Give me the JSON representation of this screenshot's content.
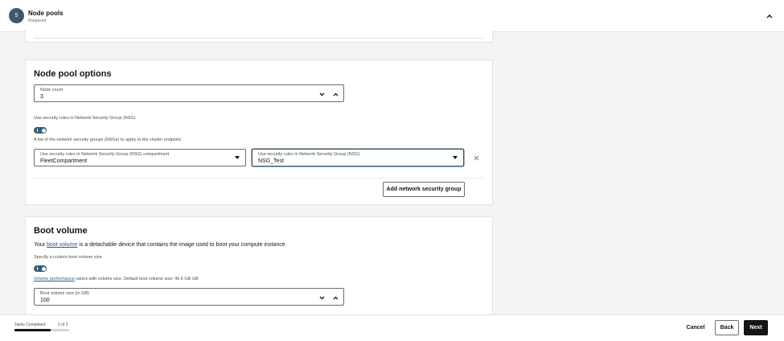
{
  "header": {
    "step_number": "5",
    "title": "Node pools",
    "subtitle": "Required",
    "collapse_icon": "chevron-up-icon"
  },
  "node_pool_options": {
    "title": "Node pool options",
    "node_count": {
      "label": "Node count",
      "value": "3"
    },
    "nsg_toggle_label": "Use security rules in Network Security Group (NSG)",
    "nsg_toggle_on": true,
    "nsg_help": "A list of the network security groups (NSGs) to apply to the cluster endpoint.",
    "nsg_compartment": {
      "label": "Use security rules in Network Security Group (NSG) compartment",
      "value": "FleetCompartment"
    },
    "nsg_select": {
      "label": "Use security rules in Network Security Group (NSG)",
      "value": "NSG_Test"
    },
    "add_nsg_button": "Add network security group"
  },
  "boot_volume": {
    "title": "Boot volume",
    "desc_prefix": "Your",
    "desc_link": "boot volume",
    "desc_suffix": "is a detachable device that contains the image used to boot your compute instance.",
    "custom_size_label": "Specify a custom boot volume size",
    "custom_size_on": true,
    "perf_link": "Volume performance",
    "perf_suffix": "varies with volume size. Default boot volume size: 46.6 GB GB",
    "size_field": {
      "label": "Boot volume size (in GB)",
      "value": "100"
    }
  },
  "footer": {
    "tasks_label": "Tasks Completed",
    "tasks_count": "2 of 3",
    "progress": 0.6667,
    "cancel": "Cancel",
    "back": "Back",
    "next": "Next"
  },
  "colors": {
    "accent": "#3a5a6e",
    "link": "#2c5a8a",
    "primary_button": "#161513"
  }
}
